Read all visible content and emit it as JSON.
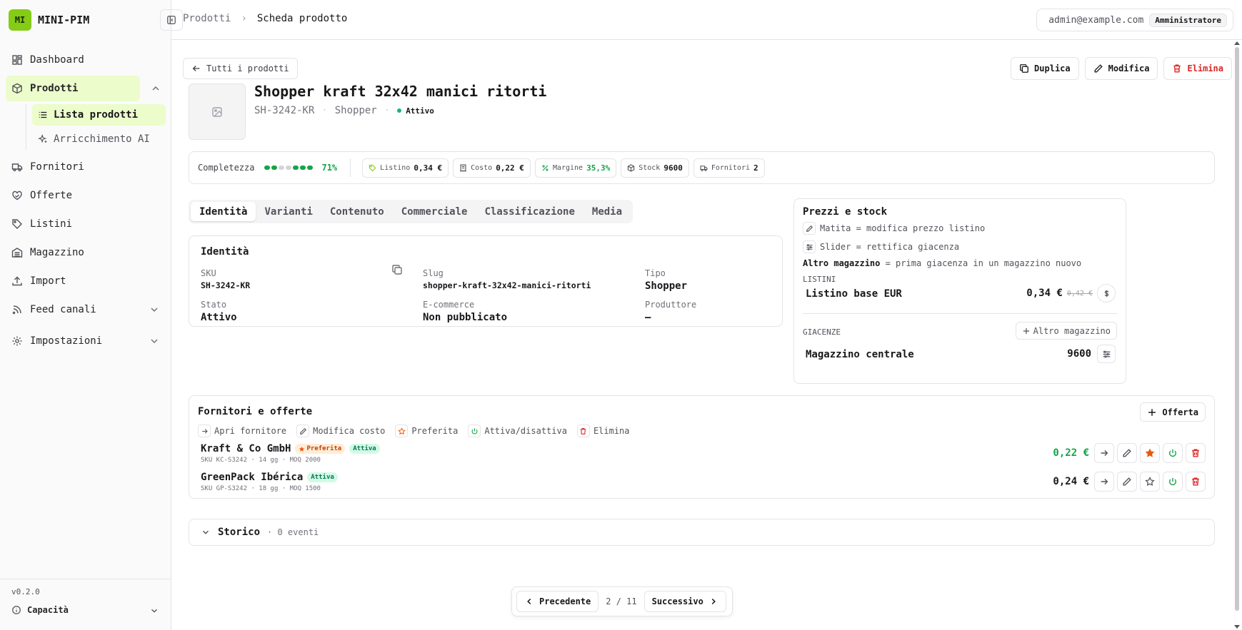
{
  "brand": {
    "logo": "MI",
    "name": "MINI-PIM"
  },
  "sidebar": {
    "items": [
      {
        "label": "Dashboard",
        "icon": "dashboard-icon"
      },
      {
        "label": "Prodotti",
        "icon": "box-icon"
      },
      {
        "label": "Fornitori",
        "icon": "truck-icon"
      },
      {
        "label": "Offerte",
        "icon": "handshake-icon"
      },
      {
        "label": "Listini",
        "icon": "tag-icon"
      },
      {
        "label": "Magazzino",
        "icon": "warehouse-icon"
      },
      {
        "label": "Import",
        "icon": "upload-icon"
      },
      {
        "label": "Feed canali",
        "icon": "rss-icon"
      },
      {
        "label": "Impostazioni",
        "icon": "gear-icon"
      }
    ],
    "sub_items": [
      {
        "label": "Lista prodotti",
        "icon": "list-icon"
      },
      {
        "label": "Arricchimento AI",
        "icon": "sparkle-icon"
      }
    ],
    "version": "v0.2.0",
    "capacity": "Capacità"
  },
  "topbar": {
    "breadcrumb": [
      "Prodotti",
      "Scheda prodotto"
    ],
    "user_email": "admin@example.com",
    "role": "Amministratore"
  },
  "header": {
    "back_label": "Tutti i prodotti",
    "actions": {
      "duplicate": "Duplica",
      "edit": "Modifica",
      "delete": "Elimina"
    },
    "title": "Shopper kraft 32x42 manici ritorti",
    "sku": "SH-3242-KR",
    "category": "Shopper",
    "status": "Attivo"
  },
  "kpis": {
    "completeness_label": "Completezza",
    "completeness_value": "71%",
    "completeness_fraction": 0.71,
    "segments_on": [
      true,
      true,
      false,
      false,
      true,
      true,
      true
    ],
    "items": [
      {
        "label": "Listino",
        "value": "0,34 €",
        "icon": "tag-icon"
      },
      {
        "label": "Costo",
        "value": "0,22 €",
        "icon": "receipt-icon"
      },
      {
        "label": "Margine",
        "value": "35,3%",
        "icon": "percent-icon"
      },
      {
        "label": "Stock",
        "value": "9600",
        "icon": "box-icon"
      },
      {
        "label": "Fornitori",
        "value": "2",
        "icon": "truck-icon"
      }
    ]
  },
  "tabs": [
    "Identità",
    "Varianti",
    "Contenuto",
    "Commerciale",
    "Classificazione",
    "Media"
  ],
  "identity": {
    "title": "Identità",
    "fields": {
      "sku": {
        "label": "SKU",
        "value": "SH-3242-KR"
      },
      "slug": {
        "label": "Slug",
        "value": "shopper-kraft-32x42-manici-ritorti"
      },
      "type": {
        "label": "Tipo",
        "value": "Shopper"
      },
      "state": {
        "label": "Stato",
        "value": "Attivo"
      },
      "ecommerce": {
        "label": "E-commerce",
        "value": "Non pubblicato"
      },
      "producer": {
        "label": "Produttore",
        "value": "—"
      }
    }
  },
  "prices": {
    "title": "Prezzi e stock",
    "hint_pencil": "Matita = modifica prezzo listino",
    "hint_slider": "Slider = rettifica giacenza",
    "hint_other_bold": "Altro magazzino",
    "hint_other_rest": " = prima giacenza in un magazzino nuovo",
    "lists_label": "LISTINI",
    "list_name": "Listino base EUR",
    "list_price": "0,34 €",
    "list_old_price": "0,42 €",
    "stock_label": "GIACENZE",
    "other_warehouse": "Altro magazzino",
    "warehouse_name": "Magazzino centrale",
    "warehouse_qty": "9600"
  },
  "suppliers": {
    "title": "Fornitori e offerte",
    "add_offer": "Offerta",
    "legend": [
      "Apri fornitore",
      "Modifica costo",
      "Preferita",
      "Attiva/disattiva",
      "Elimina"
    ],
    "rows": [
      {
        "name": "Kraft & Co GmbH",
        "preferred": "Preferita",
        "active": "Attiva",
        "meta": "SKU KC-S3242 · 14 gg · MOQ 2000",
        "price": "0,22 €"
      },
      {
        "name": "GreenPack Ibérica",
        "active": "Attiva",
        "meta": "SKU GP-S3242 · 18 gg · MOQ 1500",
        "price": "0,24 €"
      }
    ]
  },
  "history": {
    "title": "Storico",
    "subtitle": "· 0 eventi"
  },
  "pager": {
    "prev": "Precedente",
    "indicator": "2 / 11",
    "next": "Successivo"
  },
  "colors": {
    "accent": "#84cc16",
    "accent_soft": "#ecfccb",
    "success": "#16a34a",
    "danger": "#dc2626",
    "preferred": "#ea580c"
  }
}
